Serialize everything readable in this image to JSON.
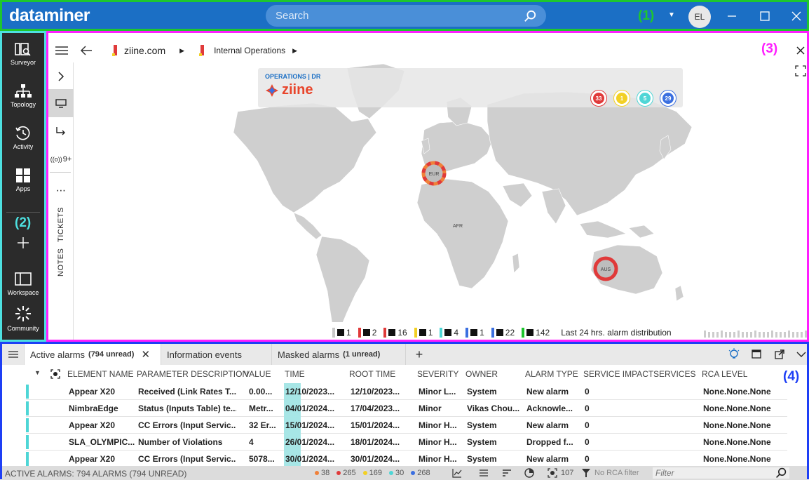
{
  "header": {
    "logo": "dataminer",
    "search_placeholder": "Search",
    "annotation_label": "(1)",
    "avatar_initials": "EL"
  },
  "sidebar": {
    "annotation_label": "(2)",
    "items": [
      {
        "label": "Surveyor",
        "icon": "surveyor-icon"
      },
      {
        "label": "Topology",
        "icon": "topology-icon"
      },
      {
        "label": "Activity",
        "icon": "activity-icon"
      },
      {
        "label": "Apps",
        "icon": "apps-icon"
      },
      {
        "label": "Workspace",
        "icon": "workspace-icon"
      },
      {
        "label": "Community",
        "icon": "community-icon"
      }
    ]
  },
  "main": {
    "annotation_label": "(3)",
    "breadcrumbs": [
      "ziine.com",
      "Internal Operations"
    ],
    "vbar": {
      "signal_count": "9+",
      "tickets": "TICKETS",
      "notes": "NOTES"
    },
    "ops_card": {
      "title": "OPERATIONS | DR",
      "brand": "ziine",
      "badges": [
        {
          "value": "33",
          "color": "#e03a3a"
        },
        {
          "value": "1",
          "color": "#f2d024"
        },
        {
          "value": "5",
          "color": "#4ed6d6"
        },
        {
          "value": "29",
          "color": "#3b6fe0"
        }
      ]
    },
    "regions": [
      {
        "label": "EUR",
        "status_color": "#f0813a"
      },
      {
        "label": "AFR",
        "status_color": ""
      },
      {
        "label": "AUS",
        "status_color": "#e03a3a"
      }
    ],
    "legend": [
      {
        "color": "#c8c8c8",
        "count": "1"
      },
      {
        "color": "#e03a3a",
        "count": "2"
      },
      {
        "color": "#e03a3a",
        "count": "16"
      },
      {
        "color": "#f2d024",
        "count": "1"
      },
      {
        "color": "#4ed6d6",
        "count": "4"
      },
      {
        "color": "#3b6fe0",
        "count": "1"
      },
      {
        "color": "#3b6fe0",
        "count": "22"
      },
      {
        "color": "#1ec62e",
        "count": "142"
      }
    ],
    "legend_note": "Last 24 hrs. alarm distribution"
  },
  "bottom": {
    "annotation_label": "(4)",
    "tabs": [
      {
        "label": "Active alarms",
        "unread": "(794 unread)"
      },
      {
        "label": "Information events",
        "unread": ""
      },
      {
        "label": "Masked alarms",
        "unread": "(1 unread)"
      }
    ],
    "columns": [
      "ELEMENT NAME",
      "PARAMETER DESCRIPTION",
      "VALUE",
      "TIME",
      "ROOT TIME",
      "SEVERITY",
      "OWNER",
      "ALARM TYPE",
      "SERVICE IMPACT",
      "SERVICES",
      "RCA LEVEL"
    ],
    "rows": [
      {
        "element": "Appear X20",
        "param": "Received (Link Rates T...",
        "value": "0.00...",
        "time": "12/10/2023...",
        "root": "12/10/2023...",
        "severity": "Minor L...",
        "owner": "System",
        "type": "New alarm",
        "impact": "0",
        "services": "",
        "rca": "None.None.None"
      },
      {
        "element": "NimbraEdge",
        "param": "Status (Inputs Table) te...",
        "value": "Metr...",
        "time": "04/01/2024...",
        "root": "17/04/2023...",
        "severity": "Minor",
        "owner": "Vikas Chou...",
        "type": "Acknowle...",
        "impact": "0",
        "services": "",
        "rca": "None.None.None"
      },
      {
        "element": "Appear X20",
        "param": "CC Errors (Input Servic...",
        "value": "32 Er...",
        "time": "15/01/2024...",
        "root": "15/01/2024...",
        "severity": "Minor H...",
        "owner": "System",
        "type": "New alarm",
        "impact": "0",
        "services": "",
        "rca": "None.None.None"
      },
      {
        "element": "SLA_OLYMPIC...",
        "param": "Number of Violations",
        "value": "4",
        "time": "26/01/2024...",
        "root": "18/01/2024...",
        "severity": "Minor H...",
        "owner": "System",
        "type": "Dropped f...",
        "impact": "0",
        "services": "",
        "rca": "None.None.None"
      },
      {
        "element": "Appear X20",
        "param": "CC Errors (Input Servic...",
        "value": "5078...",
        "time": "30/01/2024...",
        "root": "30/01/2024...",
        "severity": "Minor H...",
        "owner": "System",
        "type": "New alarm",
        "impact": "0",
        "services": "",
        "rca": "None.None.None"
      }
    ],
    "status": {
      "summary": "ACTIVE ALARMS: 794 ALARMS (794 UNREAD)",
      "counts": [
        {
          "value": "38",
          "color": "#f0813a"
        },
        {
          "value": "265",
          "color": "#e03a3a"
        },
        {
          "value": "169",
          "color": "#f2d024"
        },
        {
          "value": "30",
          "color": "#4ed6d6"
        },
        {
          "value": "268",
          "color": "#3b6fe0"
        }
      ],
      "focus_count": "107",
      "rca_filter": "No RCA filter",
      "filter_placeholder": "Filter"
    }
  }
}
